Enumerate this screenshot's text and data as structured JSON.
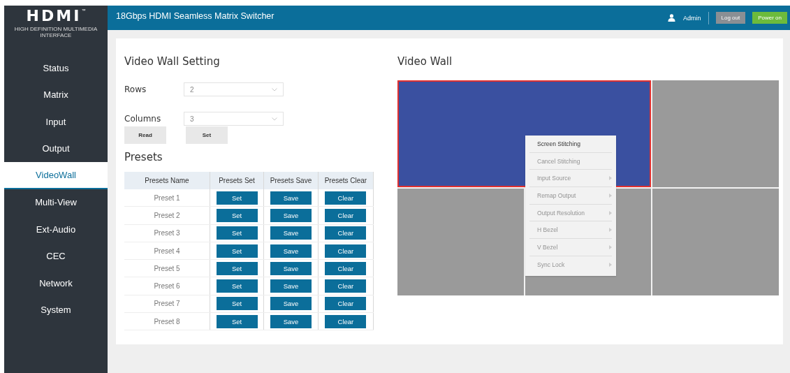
{
  "header": {
    "title": "18Gbps HDMI Seamless Matrix Switcher",
    "user": "Admin",
    "buttons": [
      {
        "label": "Log out",
        "kind": "neutral"
      },
      {
        "label": "Power on",
        "kind": "power"
      }
    ]
  },
  "logo": {
    "wordmark": "HDMI",
    "tm": "™",
    "tagline": "HIGH DEFINITION MULTIMEDIA INTERFACE"
  },
  "sidebar": {
    "items": [
      {
        "label": "Status",
        "selected": false
      },
      {
        "label": "Matrix",
        "selected": false
      },
      {
        "label": "Input",
        "selected": false
      },
      {
        "label": "Output",
        "selected": false
      },
      {
        "label": "VideoWall",
        "selected": true
      },
      {
        "label": "Multi-View",
        "selected": false
      },
      {
        "label": "Ext-Audio",
        "selected": false
      },
      {
        "label": "CEC",
        "selected": false
      },
      {
        "label": "Network",
        "selected": false
      },
      {
        "label": "System",
        "selected": false
      }
    ]
  },
  "settings": {
    "title": "Video Wall Setting",
    "fields": [
      {
        "label": "Rows",
        "value": "2"
      },
      {
        "label": "Columns",
        "value": "3"
      }
    ],
    "buttons": [
      "Read",
      "Set"
    ]
  },
  "presets": {
    "title": "Presets",
    "columns": [
      "Presets Name",
      "Presets Set",
      "Presets Save",
      "Presets Clear"
    ],
    "rows": [
      {
        "name": "Preset 1",
        "set": "Set",
        "save": "Save",
        "clear": "Clear"
      },
      {
        "name": "Preset 2",
        "set": "Set",
        "save": "Save",
        "clear": "Clear"
      },
      {
        "name": "Preset 3",
        "set": "Set",
        "save": "Save",
        "clear": "Clear"
      },
      {
        "name": "Preset 4",
        "set": "Set",
        "save": "Save",
        "clear": "Clear"
      },
      {
        "name": "Preset 5",
        "set": "Set",
        "save": "Save",
        "clear": "Clear"
      },
      {
        "name": "Preset 6",
        "set": "Set",
        "save": "Save",
        "clear": "Clear"
      },
      {
        "name": "Preset 7",
        "set": "Set",
        "save": "Save",
        "clear": "Clear"
      },
      {
        "name": "Preset 8",
        "set": "Set",
        "save": "Save",
        "clear": "Clear"
      }
    ]
  },
  "video_wall": {
    "title": "Video Wall",
    "screens": [
      {
        "kind": "stitched",
        "selected": true
      },
      {
        "kind": "single",
        "selected": false
      },
      {
        "kind": "single",
        "selected": false
      },
      {
        "kind": "single",
        "selected": false
      },
      {
        "kind": "single",
        "selected": false
      }
    ],
    "context_menu": [
      {
        "label": "Screen Stitching",
        "disabled": false,
        "submenu": false
      },
      {
        "label": "Cancel Stitching",
        "disabled": true,
        "submenu": false
      },
      {
        "label": "Input Source",
        "disabled": true,
        "submenu": true
      },
      {
        "label": "Remap Output",
        "disabled": true,
        "submenu": true
      },
      {
        "label": "Output Resolution",
        "disabled": true,
        "submenu": true
      },
      {
        "label": "H Bezel",
        "disabled": true,
        "submenu": true
      },
      {
        "label": "V Bezel",
        "disabled": true,
        "submenu": true
      },
      {
        "label": "Sync Lock",
        "disabled": true,
        "submenu": true
      }
    ]
  }
}
